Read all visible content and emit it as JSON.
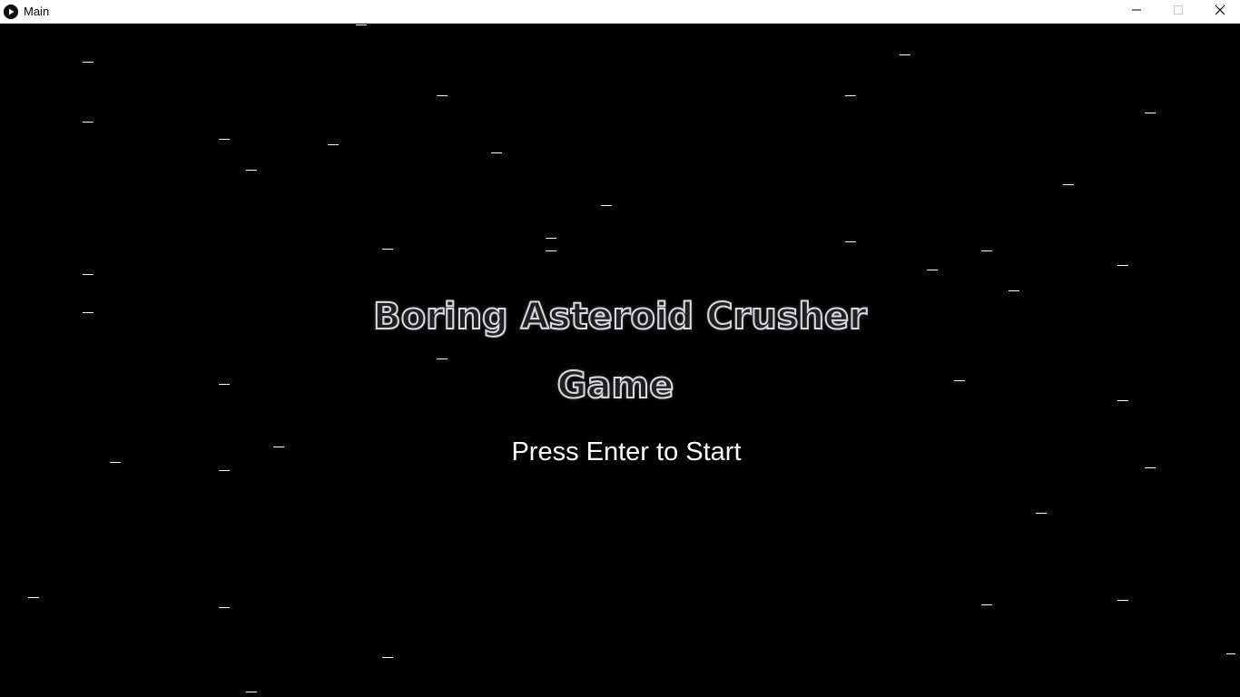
{
  "window": {
    "title": "Main",
    "icon": "play-circle-icon",
    "controls": [
      "minimize-icon",
      "maximize-icon",
      "close-icon"
    ]
  },
  "game": {
    "title_line1": "Boring Asteroid Crusher",
    "title_line2": "Game",
    "prompt": "Press Enter to Start",
    "colors": {
      "background": "#000000",
      "star": "#ffffff",
      "title_outline": "#d9dbe0",
      "prompt": "#ffffff"
    }
  }
}
